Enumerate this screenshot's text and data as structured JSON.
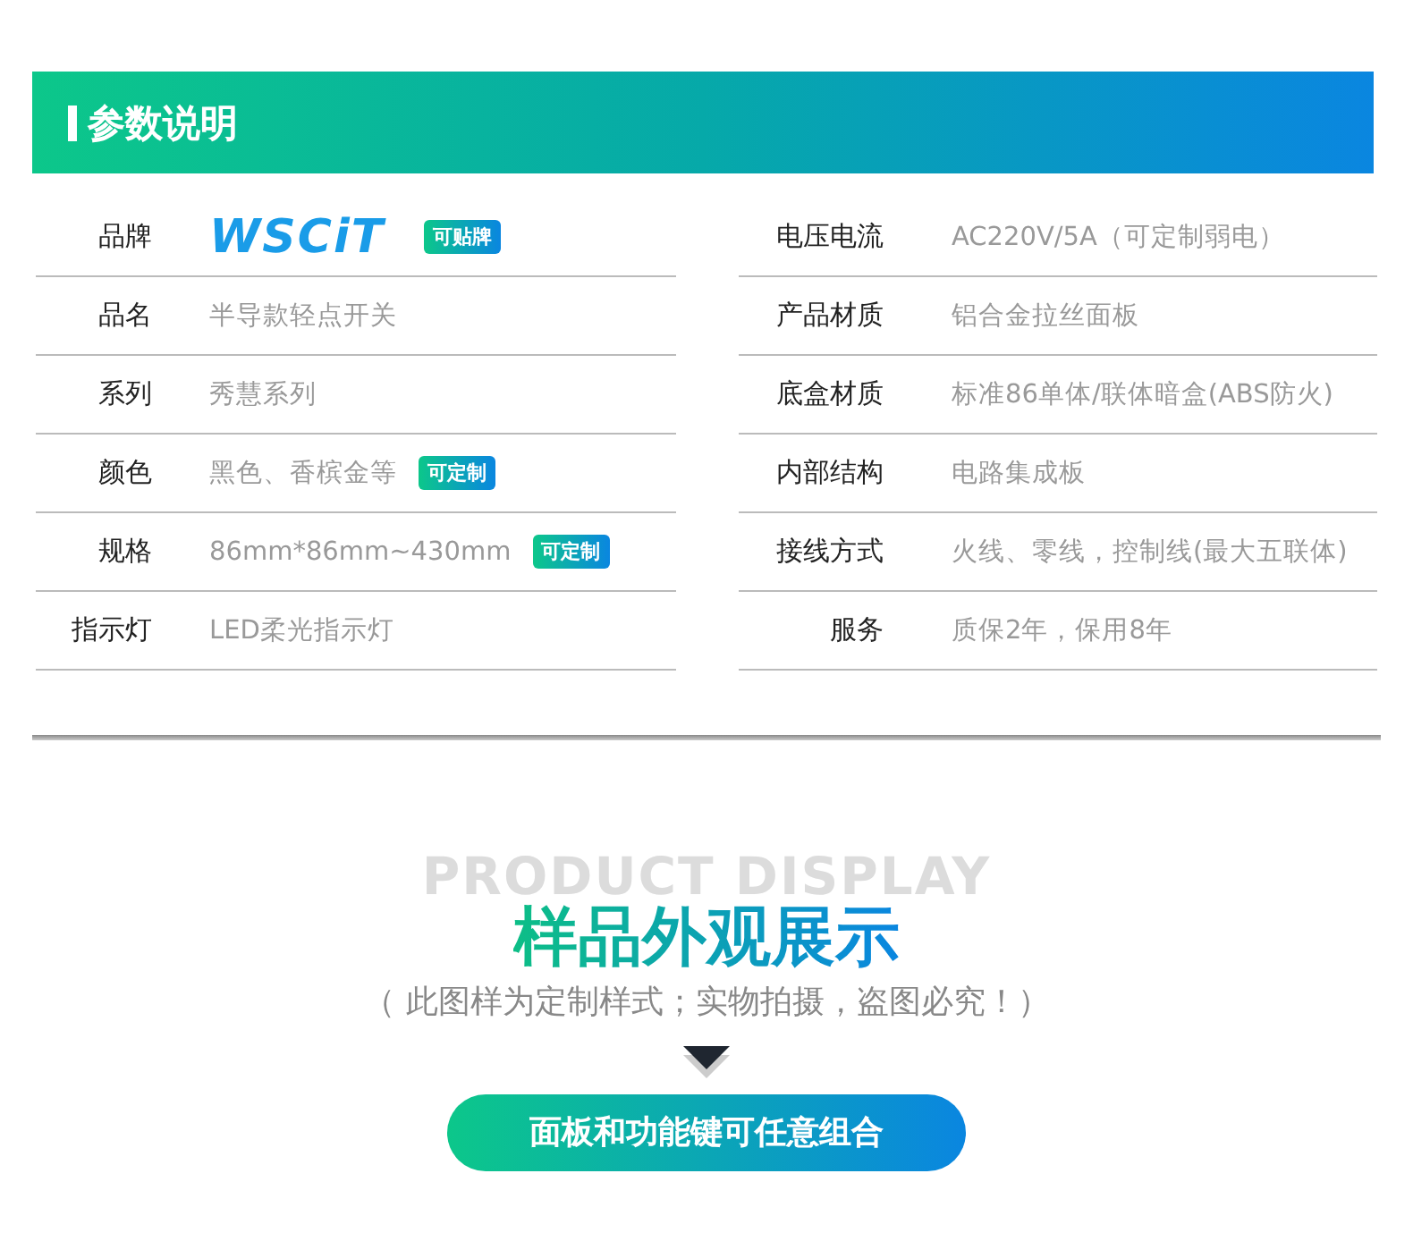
{
  "header": {
    "title": "参数说明"
  },
  "specs_left": [
    {
      "label": "品牌",
      "kind": "logo",
      "value": "WSCiT",
      "badge": "可贴牌"
    },
    {
      "label": "品名",
      "kind": "text",
      "value": "半导款轻点开关"
    },
    {
      "label": "系列",
      "kind": "text",
      "value": "秀慧系列"
    },
    {
      "label": "颜色",
      "kind": "text",
      "value": "黑色、香槟金等",
      "badge": "可定制"
    },
    {
      "label": "规格",
      "kind": "text",
      "value": "86mm*86mm~430mm",
      "badge": "可定制"
    },
    {
      "label": "指示灯",
      "kind": "text",
      "value": "LED柔光指示灯"
    }
  ],
  "specs_right": [
    {
      "label": "电压电流",
      "kind": "text",
      "value": "AC220V/5A（可定制弱电）"
    },
    {
      "label": "产品材质",
      "kind": "text",
      "value": "铝合金拉丝面板"
    },
    {
      "label": "底盒材质",
      "kind": "text",
      "value": "标准86单体/联体暗盒(ABS防火)"
    },
    {
      "label": "内部结构",
      "kind": "text",
      "value": "电路集成板"
    },
    {
      "label": "接线方式",
      "kind": "text",
      "value": "火线、零线，控制线(最大五联体)"
    },
    {
      "label": "服务",
      "kind": "text",
      "value": "质保2年，保用8年"
    }
  ],
  "display": {
    "ghost_title": "PRODUCT DISPLAY",
    "title": "样品外观展示",
    "subtitle": "（ 此图样为定制样式；实物拍摄，盗图必究！）",
    "button": "面板和功能键可任意组合"
  }
}
